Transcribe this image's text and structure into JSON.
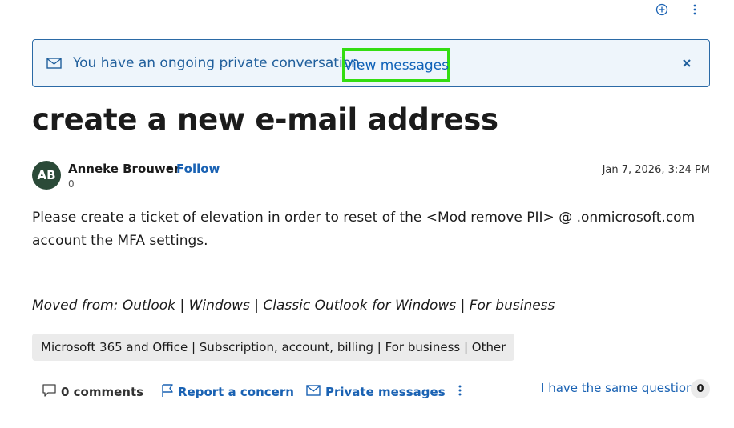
{
  "top_actions": {
    "add_icon": "circle-plus-icon",
    "more_icon": "vertical-ellipsis-icon"
  },
  "banner": {
    "icon": "mail-icon",
    "text": "You have an ongoing private conversation.",
    "link_label": "View messages",
    "close_icon": "close-icon",
    "highlight_color": "#33dd11"
  },
  "question": {
    "title": "create a new e-mail address",
    "author": {
      "initials": "AB",
      "name": "Anneke Brouwer",
      "separator": "•",
      "follow_label": "Follow",
      "reputation": "0"
    },
    "date": "Jan 7, 2026, 3:24 PM",
    "body": "Please create a ticket of elevation in order to reset of the <Mod remove PII> @ .onmicrosoft.com account the MFA settings.",
    "moved_from": "Moved from: Outlook | Windows | Classic Outlook for Windows | For business",
    "tag": "Microsoft 365 and Office | Subscription, account, billing | For business | Other"
  },
  "actions": {
    "comments_label": "0 comments",
    "report_label": "Report a concern",
    "private_label": "Private messages",
    "same_question_label": "I have the same question",
    "same_question_count": "0"
  },
  "colors": {
    "link": "#1a62b3",
    "banner_bg": "#eef5fb",
    "avatar_bg": "#2b4a38"
  }
}
